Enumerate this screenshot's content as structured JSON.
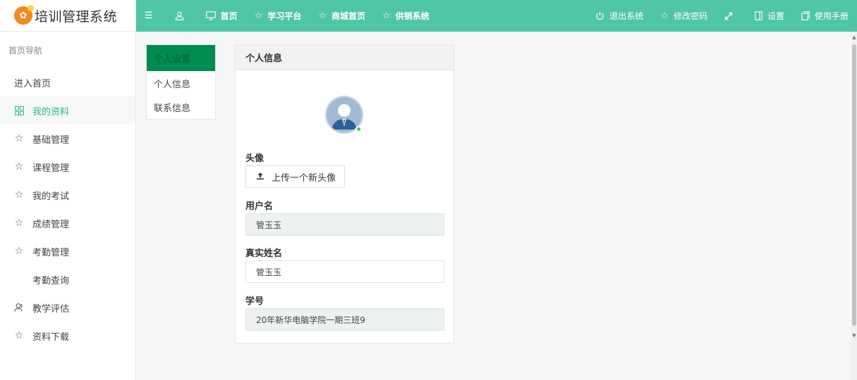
{
  "app": {
    "title": "培训管理系统",
    "logo_icon": "logo-icon"
  },
  "sidebar": {
    "header": "首页导航",
    "items": [
      {
        "label": "进入首页",
        "icon": "",
        "active": false
      },
      {
        "label": "我的资料",
        "icon": "grid-icon",
        "active": true
      },
      {
        "label": "基础管理",
        "icon": "star-icon",
        "active": false
      },
      {
        "label": "课程管理",
        "icon": "star-icon",
        "active": false
      },
      {
        "label": "我的考试",
        "icon": "star-icon",
        "active": false
      },
      {
        "label": "成绩管理",
        "icon": "star-icon",
        "active": false
      },
      {
        "label": "考勤管理",
        "icon": "star-icon",
        "active": false
      },
      {
        "label": "考勤查询",
        "icon": "",
        "active": false
      },
      {
        "label": "教学评估",
        "icon": "users-icon",
        "active": false
      },
      {
        "label": "资料下载",
        "icon": "star-icon",
        "active": false
      }
    ]
  },
  "topbar": {
    "left": [
      {
        "label": "",
        "icon": "menu-icon"
      },
      {
        "label": "",
        "icon": "user-icon"
      },
      {
        "label": "首页",
        "icon": "monitor-icon"
      },
      {
        "label": "学习平台",
        "icon": "star-icon"
      },
      {
        "label": "商城首页",
        "icon": "star-icon"
      },
      {
        "label": "供销系统",
        "icon": "star-icon"
      }
    ],
    "right": [
      {
        "label": "退出系统",
        "icon": "power-icon"
      },
      {
        "label": "修改密码",
        "icon": "star-icon"
      },
      {
        "label": "",
        "icon": "fullscreen-icon"
      },
      {
        "label": "设置",
        "icon": "panel-icon"
      },
      {
        "label": "使用手册",
        "icon": "book-icon"
      }
    ]
  },
  "left_menu": {
    "header": "个人设置",
    "items": [
      "个人信息",
      "联系信息"
    ]
  },
  "panel": {
    "title": "个人信息",
    "avatar_label": "头像",
    "upload_button": "上传一个新头像",
    "username_label": "用户名",
    "username_value": "管玉玉",
    "realname_label": "真实姓名",
    "realname_value": "管玉玉",
    "student_id_label": "学号",
    "student_id_value": "20年新华电脑学院一期三班9"
  },
  "colors": {
    "topbar": "#4fc6a5",
    "active_text": "#2bb88a",
    "menu_header": "#008c4f"
  }
}
